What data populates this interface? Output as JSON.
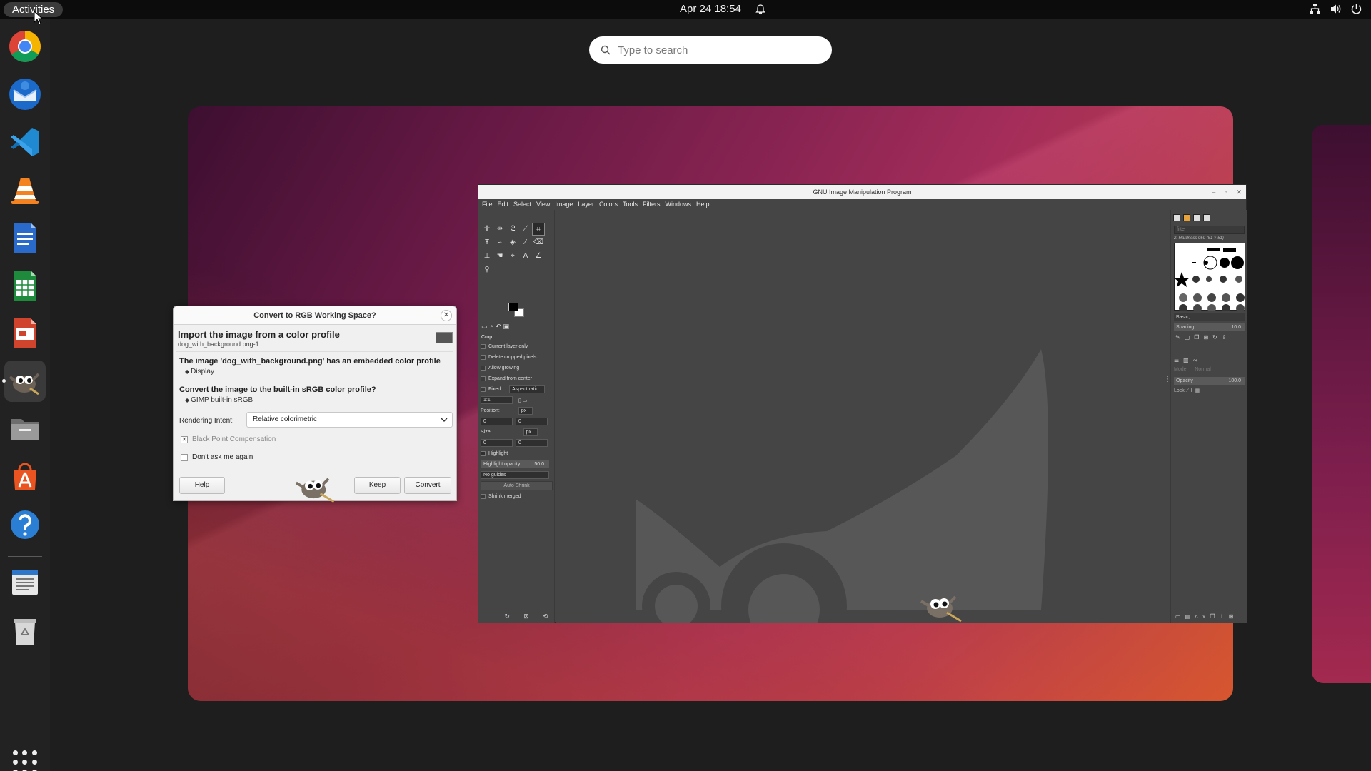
{
  "topbar": {
    "activities": "Activities",
    "clock": "Apr 24  18:54"
  },
  "search": {
    "placeholder": "Type to search"
  },
  "dock": {
    "apps": [
      {
        "name": "Google Chrome",
        "icon": "chrome-icon"
      },
      {
        "name": "Thunderbird Mail",
        "icon": "thunderbird-icon"
      },
      {
        "name": "Visual Studio Code",
        "icon": "vscode-icon"
      },
      {
        "name": "VLC Media Player",
        "icon": "vlc-icon"
      },
      {
        "name": "LibreOffice Writer",
        "icon": "writer-icon"
      },
      {
        "name": "LibreOffice Calc",
        "icon": "calc-icon"
      },
      {
        "name": "LibreOffice Impress",
        "icon": "impress-icon"
      },
      {
        "name": "GIMP",
        "icon": "gimp-icon"
      },
      {
        "name": "Files",
        "icon": "files-icon"
      },
      {
        "name": "Ubuntu Software",
        "icon": "software-icon"
      },
      {
        "name": "Help",
        "icon": "help-icon"
      },
      {
        "name": "Text Editor",
        "icon": "text-editor-icon"
      },
      {
        "name": "Trash",
        "icon": "trash-icon"
      }
    ]
  },
  "gimp": {
    "title": "GNU Image Manipulation Program",
    "menu": [
      "File",
      "Edit",
      "Select",
      "View",
      "Image",
      "Layer",
      "Colors",
      "Tools",
      "Filters",
      "Windows",
      "Help"
    ],
    "tool_options": {
      "header": "Crop",
      "current_layer_only": "Current layer only",
      "delete_cropped": "Delete cropped pixels",
      "allow_growing": "Allow growing",
      "expand_center": "Expand from center",
      "fixed": "Fixed",
      "aspect_ratio": "Aspect ratio",
      "ratio_value": "1:1",
      "position_label": "Position:",
      "size_label": "Size:",
      "unit": "px",
      "zero": "0",
      "highlight": "Highlight",
      "highlight_opacity": "Highlight opacity",
      "highlight_opacity_value": "50.0",
      "guides": "No guides",
      "auto_shrink": "Auto Shrink",
      "shrink_merged": "Shrink merged"
    },
    "right_dock": {
      "filter_placeholder": "filter",
      "brush_label": "2. Hardness 050 (51 × 51)",
      "brush_set": "Basic,",
      "spacing_label": "Spacing",
      "spacing_value": "10.0",
      "mode_label": "Mode",
      "mode_value": "Normal",
      "opacity_label": "Opacity",
      "opacity_value": "100.0",
      "lock_label": "Lock:"
    }
  },
  "dialog": {
    "title": "Convert to RGB Working Space?",
    "heading": "Import the image from a color profile",
    "subheading": "dog_with_background.png-1",
    "question1": "The image 'dog_with_background.png' has an embedded color profile",
    "expander1": "Display",
    "question2": "Convert the image to the built-in sRGB color profile?",
    "expander2": "GIMP built-in sRGB",
    "intent_label": "Rendering Intent:",
    "intent_value": "Relative colorimetric",
    "black_point": "Black Point Compensation",
    "dont_ask": "Don't ask me again",
    "help": "Help",
    "keep": "Keep",
    "convert": "Convert"
  },
  "colors": {
    "accent_ubuntu": "#e95420",
    "dock_bg": "#222222",
    "topbar_bg": "#0c0c0c",
    "gimp_bg": "#454545"
  }
}
